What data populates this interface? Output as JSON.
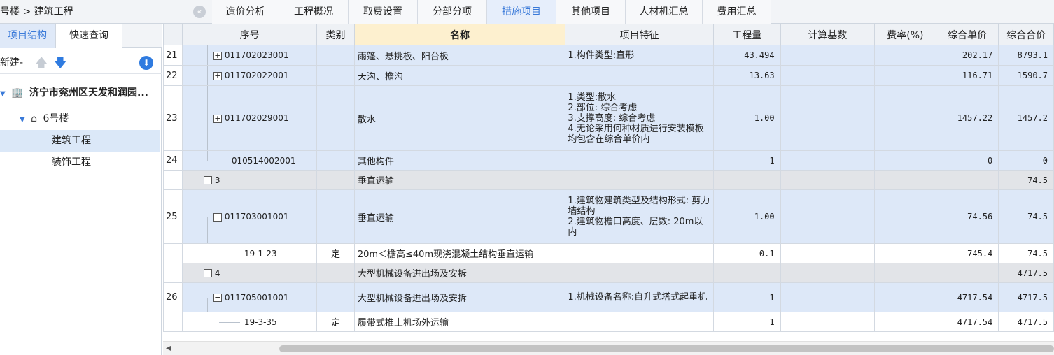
{
  "breadcrumb": "号楼 > 建筑工程",
  "tabs": [
    "造价分析",
    "工程概况",
    "取费设置",
    "分部分项",
    "措施项目",
    "其他项目",
    "人材机汇总",
    "费用汇总"
  ],
  "active_tab": "措施项目",
  "left_panel": {
    "tabs": [
      "项目结构",
      "快速查询"
    ],
    "new_label": "新建-",
    "tree": {
      "project": "济宁市兖州区天发和润园...",
      "building": "6号楼",
      "items": [
        "建筑工程",
        "装饰工程"
      ]
    }
  },
  "table": {
    "headers": [
      "序号",
      "类别",
      "名称",
      "项目特征",
      "工程量",
      "计算基数",
      "费率(%)",
      "综合单价",
      "综合合价"
    ],
    "rows": [
      {
        "num": "21",
        "code": "011702023001",
        "cat": "",
        "name": "雨篷、悬挑板、阳台板",
        "feat": "1.构件类型:直形",
        "qty": "43.494",
        "base": "",
        "rate": "",
        "price": "202.17",
        "total": "8793.1"
      },
      {
        "num": "22",
        "code": "011702022001",
        "cat": "",
        "name": "天沟、檐沟",
        "feat": "",
        "qty": "13.63",
        "base": "",
        "rate": "",
        "price": "116.71",
        "total": "1590.7"
      },
      {
        "num": "23",
        "code": "011702029001",
        "cat": "",
        "name": "散水",
        "feat": "1.类型:散水\n2.部位: 综合考虑\n3.支撑高度: 综合考虑\n4.无论采用何种材质进行安装模板均包含在综合单价内",
        "qty": "1.00",
        "base": "",
        "rate": "",
        "price": "1457.22",
        "total": "1457.2"
      },
      {
        "num": "24",
        "code": "010514002001",
        "cat": "",
        "name": "其他构件",
        "feat": "",
        "qty": "1",
        "base": "",
        "rate": "",
        "price": "0",
        "total": "0"
      },
      {
        "num": "",
        "code": "3",
        "cat": "",
        "name": "垂直运输",
        "feat": "",
        "qty": "",
        "base": "",
        "rate": "",
        "price": "",
        "total": "74.5"
      },
      {
        "num": "25",
        "code": "011703001001",
        "cat": "",
        "name": "垂直运输",
        "feat": "1.建筑物建筑类型及结构形式: 剪力墙结构\n2.建筑物檐口高度、层数: 20m以内",
        "qty": "1.00",
        "base": "",
        "rate": "",
        "price": "74.56",
        "total": "74.5"
      },
      {
        "num": "",
        "code": "19-1-23",
        "cat": "定",
        "name": "20m＜檐高≤40m现浇混凝土结构垂直运输",
        "feat": "",
        "qty": "0.1",
        "base": "",
        "rate": "",
        "price": "745.4",
        "total": "74.5"
      },
      {
        "num": "",
        "code": "4",
        "cat": "",
        "name": "大型机械设备进出场及安拆",
        "feat": "",
        "qty": "",
        "base": "",
        "rate": "",
        "price": "",
        "total": "4717.5"
      },
      {
        "num": "26",
        "code": "011705001001",
        "cat": "",
        "name": "大型机械设备进出场及安拆",
        "feat": "1.机械设备名称:自升式塔式起重机",
        "qty": "1",
        "base": "",
        "rate": "",
        "price": "4717.54",
        "total": "4717.5"
      },
      {
        "num": "",
        "code": "19-3-35",
        "cat": "定",
        "name": "履带式推土机场外运输",
        "feat": "",
        "qty": "1",
        "base": "",
        "rate": "",
        "price": "4717.54",
        "total": "4717.5"
      }
    ]
  },
  "colors": {
    "accent": "#3a7ad9",
    "row_blue": "#dde8f8",
    "row_gray": "#e2e4e8",
    "name_header": "#fdf0cf"
  },
  "icons": [
    "collapse-icon",
    "arrow-up-icon",
    "arrow-down-icon",
    "download-icon",
    "building-icon",
    "home-icon",
    "plus-box-icon",
    "minus-box-icon"
  ]
}
